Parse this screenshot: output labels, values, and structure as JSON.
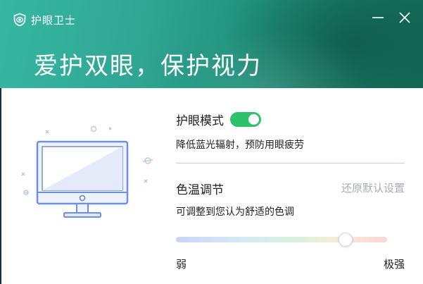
{
  "window": {
    "title": "护眼卫士",
    "slogan": "爱护双眼，保护视力"
  },
  "eye_mode": {
    "label": "护眼模式",
    "enabled": true,
    "description": "降低蓝光辐射，预防用眼疲劳"
  },
  "color_temperature": {
    "label": "色温调节",
    "reset_label": "还原默认设置",
    "description": "可调整到您认为舒适的色调",
    "min_label": "弱",
    "max_label": "极强",
    "value": 0.8
  },
  "icons": {
    "app": "eye-shield-icon",
    "minimize": "minimize-icon",
    "close": "close-icon",
    "illustration": "monitor-illustration"
  },
  "colors": {
    "header_start": "#36b7a3",
    "header_end": "#136c5a",
    "toggle_on": "#2dc26b",
    "monitor_stroke": "#6f8fe0",
    "reset_link": "#a7adb4"
  }
}
